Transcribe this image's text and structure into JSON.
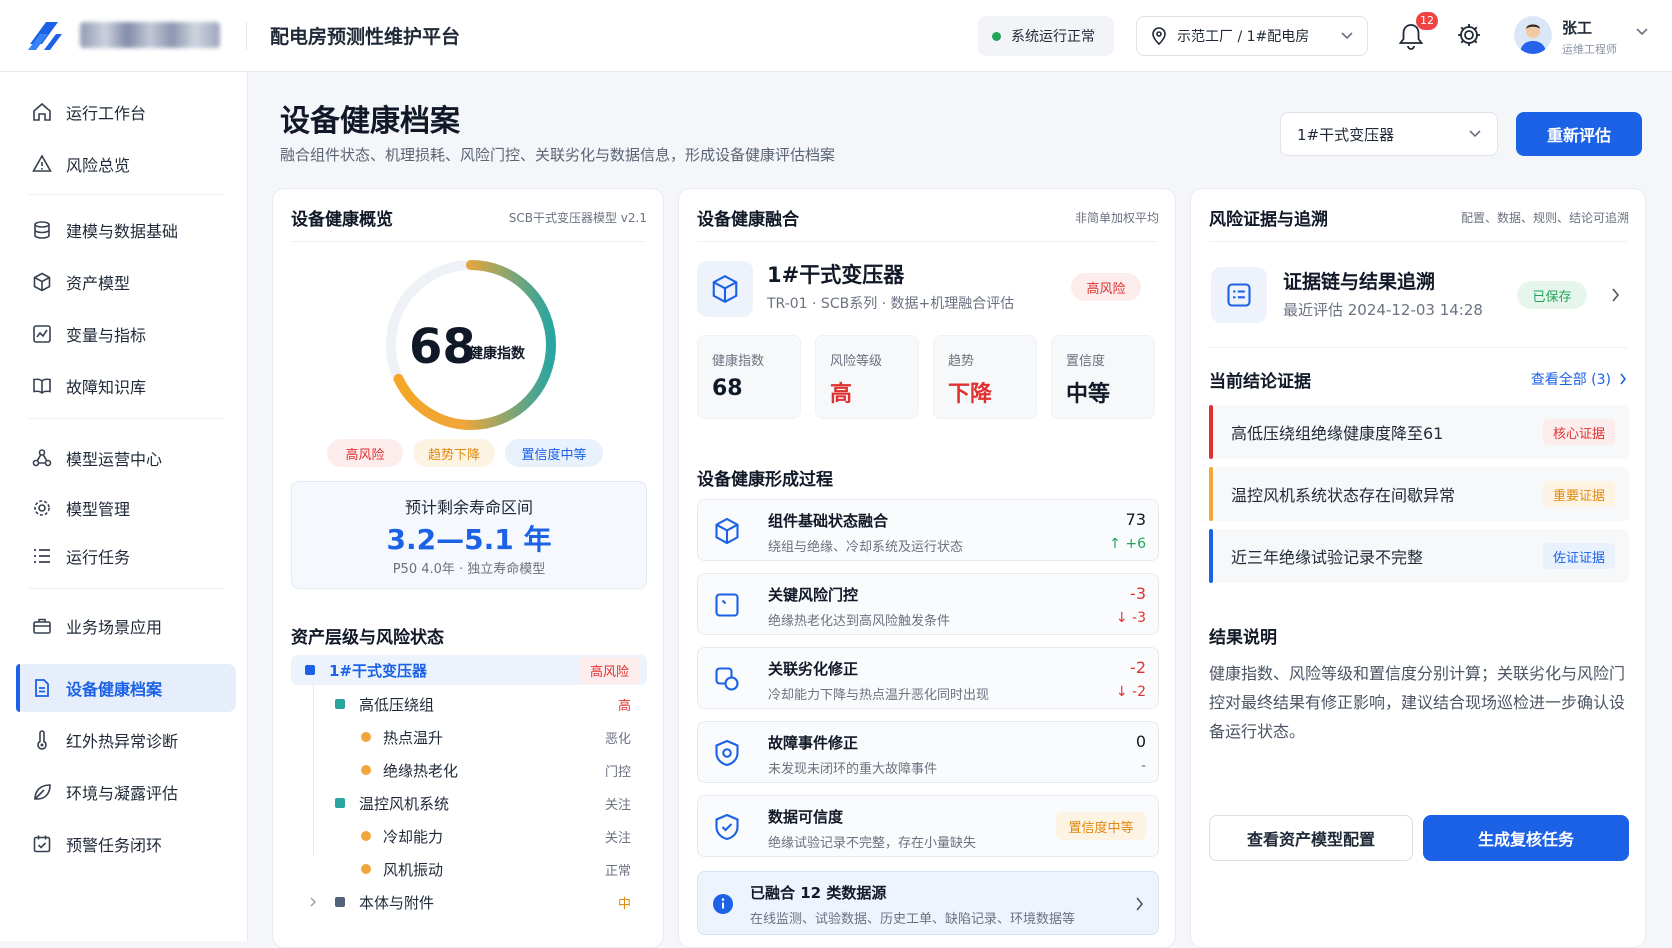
{
  "header": {
    "app_title": "配电房预测性维护平台",
    "status_text": "系统运行正常",
    "location": "示范工厂 / 1#配电房",
    "notification_count": "12",
    "user_name": "张工",
    "user_role": "运维工程师"
  },
  "sidebar": {
    "items": [
      {
        "label": "运行工作台",
        "icon": "home-icon"
      },
      {
        "label": "风险总览",
        "icon": "warning-icon"
      },
      {
        "label": "建模与数据基础",
        "icon": "database-icon"
      },
      {
        "label": "资产模型",
        "icon": "cube-icon"
      },
      {
        "label": "变量与指标",
        "icon": "chart-icon"
      },
      {
        "label": "故障知识库",
        "icon": "book-icon"
      },
      {
        "label": "模型运营中心",
        "icon": "network-icon"
      },
      {
        "label": "模型管理",
        "icon": "gear-icon"
      },
      {
        "label": "运行任务",
        "icon": "list-icon"
      },
      {
        "label": "业务场景应用",
        "icon": "briefcase-icon"
      },
      {
        "label": "设备健康档案",
        "icon": "file-icon",
        "active": true
      },
      {
        "label": "红外热异常诊断",
        "icon": "thermometer-icon"
      },
      {
        "label": "环境与凝露评估",
        "icon": "leaf-icon"
      },
      {
        "label": "预警任务闭环",
        "icon": "calendar-check-icon"
      }
    ]
  },
  "page": {
    "title": "设备健康档案",
    "subtitle": "融合组件状态、机理损耗、风险门控、关联劣化与数据信息，形成设备健康评估档案",
    "device_select": "1#干式变压器",
    "reassess_label": "重新评估"
  },
  "overview": {
    "title": "设备健康概览",
    "meta": "SCB干式变压器模型 v2.1",
    "health_index": "68",
    "health_label": "健康指数",
    "health_fraction": 0.68,
    "chips": [
      "高风险",
      "趋势下降",
      "置信度中等"
    ],
    "life_title": "预计剩余寿命区间",
    "life_value": "3.2—5.1 年",
    "life_sub": "P50 4.0年 · 独立寿命模型",
    "tree_title": "资产层级与风险状态",
    "tree": [
      {
        "label": "1#干式变压器",
        "status": "高风险"
      },
      {
        "label": "高低压绕组",
        "status": "高"
      },
      {
        "label": "热点温升",
        "status": "恶化"
      },
      {
        "label": "绝缘热老化",
        "status": "门控"
      },
      {
        "label": "温控风机系统",
        "status": "关注"
      },
      {
        "label": "冷却能力",
        "status": "关注"
      },
      {
        "label": "风机振动",
        "status": "正常"
      },
      {
        "label": "本体与附件",
        "status": "中"
      }
    ]
  },
  "fusion": {
    "title": "设备健康融合",
    "meta": "非简单加权平均",
    "device_name": "1#干式变压器",
    "device_meta": "TR-01 · SCB系列 · 数据+机理融合评估",
    "risk_tag": "高风险",
    "stats": [
      {
        "label": "健康指数",
        "value": "68"
      },
      {
        "label": "风险等级",
        "value": "高"
      },
      {
        "label": "趋势",
        "value": "下降"
      },
      {
        "label": "置信度",
        "value": "中等"
      }
    ],
    "process_title": "设备健康形成过程",
    "process": [
      {
        "title": "组件基础状态融合",
        "sub": "绕组与绝缘、冷却系统及运行状态",
        "value": "73",
        "delta": "+6"
      },
      {
        "title": "关键风险门控",
        "sub": "绝缘热老化达到高风险触发条件",
        "value": "-3",
        "delta": "-3"
      },
      {
        "title": "关联劣化修正",
        "sub": "冷却能力下降与热点温升恶化同时出现",
        "value": "-2",
        "delta": "-2"
      },
      {
        "title": "故障事件修正",
        "sub": "未发现未闭环的重大故障事件",
        "value": "0",
        "delta": "-"
      },
      {
        "title": "数据可信度",
        "sub": "绝缘试验记录不完整，存在小量缺失",
        "tag": "置信度中等"
      }
    ],
    "info_title": "已融合 12 类数据源",
    "info_sub": "在线监测、试验数据、历史工单、缺陷记录、环境数据等"
  },
  "evidence": {
    "title": "风险证据与追溯",
    "meta": "配置、数据、规则、结论可追溯",
    "chain_title": "证据链与结果追溯",
    "chain_time": "最近评估 2024-12-03 14:28",
    "saved_tag": "已保存",
    "current_title": "当前结论证据",
    "view_all": "查看全部 (3)",
    "items": [
      {
        "text": "高低压绕组绝缘健康度降至61",
        "tag": "核心证据"
      },
      {
        "text": "温控风机系统状态存在间歇异常",
        "tag": "重要证据"
      },
      {
        "text": "近三年绝缘试验记录不完整",
        "tag": "佐证证据"
      }
    ],
    "result_title": "结果说明",
    "result_text": "健康指数、风险等级和置信度分别计算；关联劣化与风险门控对最终结果有修正影响，建议结合现场巡检进一步确认设备运行状态。",
    "btn_config": "查看资产模型配置",
    "btn_task": "生成复核任务"
  }
}
